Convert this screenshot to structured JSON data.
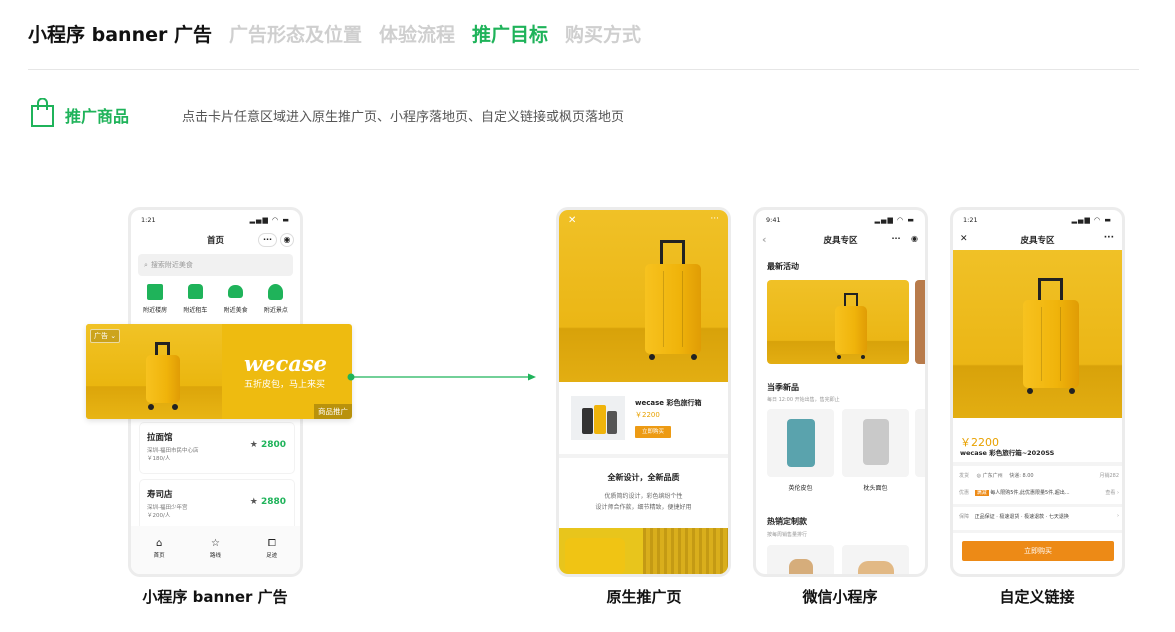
{
  "tabs": [
    {
      "label": "小程序 banner 广告",
      "state": "dark"
    },
    {
      "label": "广告形态及位置",
      "state": "inactive"
    },
    {
      "label": "体验流程",
      "state": "inactive"
    },
    {
      "label": "推广目标",
      "state": "active"
    },
    {
      "label": "购买方式",
      "state": "inactive"
    }
  ],
  "colors": {
    "accent": "#1fb35a",
    "banner_bg": "#eebb10",
    "buy_orange": "#ed8a16",
    "price_orange": "#e8a100"
  },
  "promo": {
    "icon": "shopping-bag-icon",
    "label": "推广商品",
    "description": "点击卡片任意区域进入原生推广页、小程序落地页、自定义链接或枫页落地页"
  },
  "phone1": {
    "time": "1:21",
    "title": "首页",
    "search_placeholder": "搜索附近美食",
    "categories": [
      "附近楼房",
      "附近租车",
      "附近美食",
      "附近景点"
    ],
    "banner": {
      "ad_tag": "广告",
      "brand": "wecase",
      "slogan": "五折皮包，马上来买",
      "promo_tag": "商品推广"
    },
    "list": [
      {
        "name": "拉面馆",
        "addr": "深圳-福田市民中心店",
        "price": "￥180/人",
        "score": "2800"
      },
      {
        "name": "寿司店",
        "addr": "深圳-福田少年宫",
        "price": "￥200/人",
        "score": "2880"
      }
    ],
    "tabbar": [
      {
        "label": "首页",
        "icon": "home-icon"
      },
      {
        "label": "路线",
        "icon": "star-icon"
      },
      {
        "label": "足迹",
        "icon": "bookmark-icon"
      }
    ]
  },
  "phone2": {
    "product_name": "wecase 彩色旅行箱",
    "price": "￥2200",
    "buy": "立即购买",
    "headline": "全新设计，全新品质",
    "desc1": "优质简约设计，彩色缤纷个性",
    "desc2": "设计师合作款，细节精致，便捷好用"
  },
  "phone3": {
    "time": "9:41",
    "title": "皮具专区",
    "section1": "最新活动",
    "section2": "当季新品",
    "section2_sub": "每日 12:00 开始出售，售完即止",
    "products": [
      "英伦皮包",
      "枕头面包"
    ],
    "section3": "热销定制款",
    "section3_sub": "按每周销售量排行"
  },
  "phone4": {
    "time": "1:21",
    "title": "皮具专区",
    "price": "￥2200",
    "product": "wecase 彩色旅行箱~2020SS",
    "row1": {
      "a": "发货",
      "b": "广东广州",
      "c": "快递: 8.00",
      "d": "月销282"
    },
    "row2": {
      "a": "优惠",
      "tag": "满减",
      "text": "每人限购5件,此优惠限量5件,超出...",
      "link": "查看"
    },
    "row3": {
      "a": "保障",
      "text": "正品保证 · 极速退货 · 极速退款 · 七天退换"
    },
    "buy": "立即购买"
  },
  "captions": [
    "小程序 banner 广告",
    "原生推广页",
    "微信小程序",
    "自定义链接"
  ]
}
